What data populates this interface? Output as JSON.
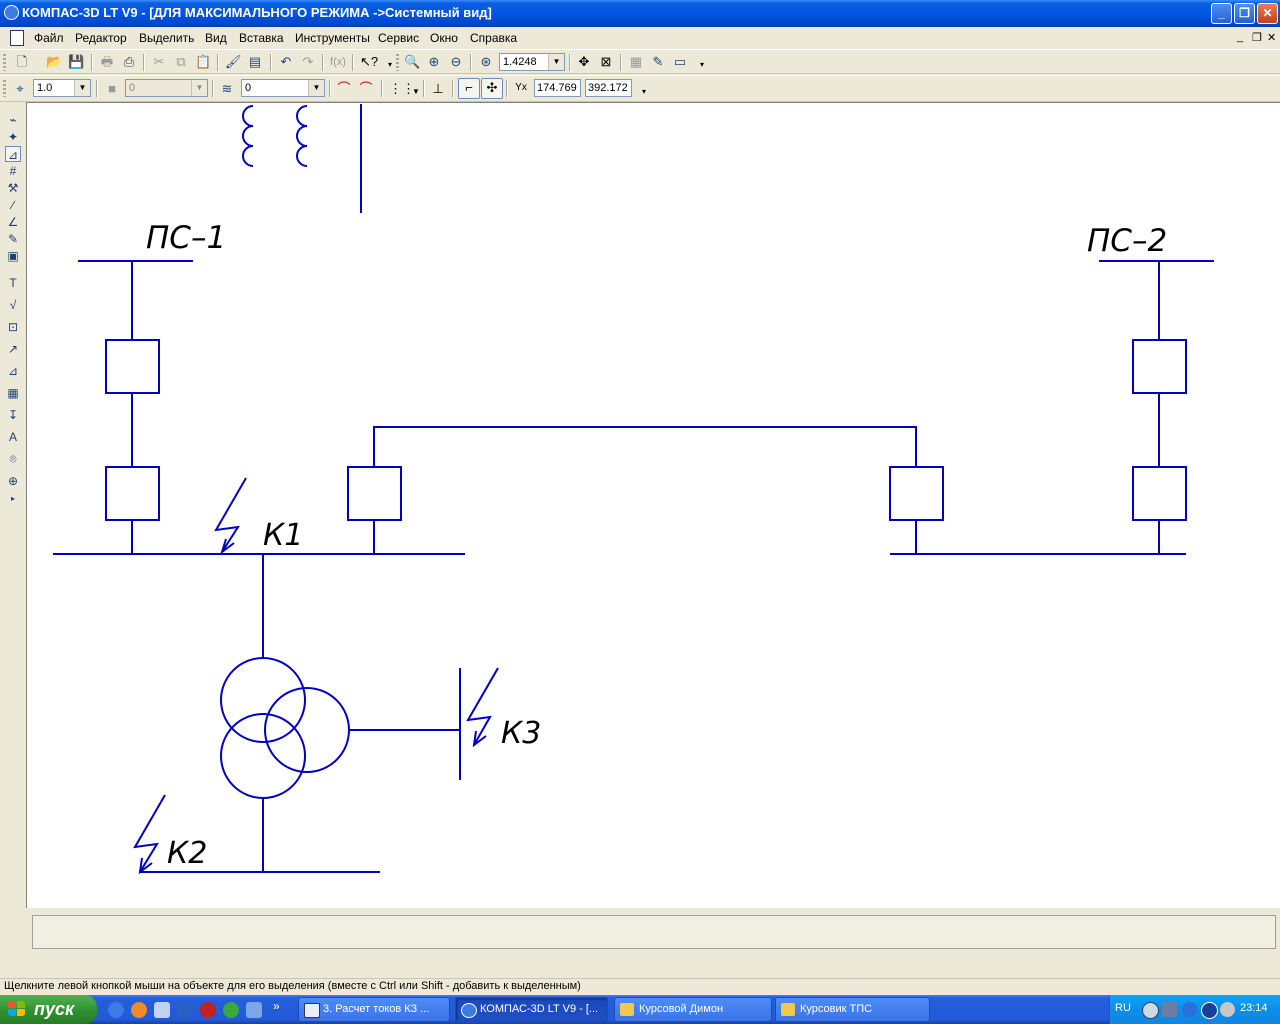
{
  "window": {
    "title": "КОМПАС-3D LT V9 - [ДЛЯ МАКСИМАЛЬНОГО РЕЖИМА ->Системный вид]",
    "minimize": "_",
    "maximize": "❐",
    "close": "✕"
  },
  "menu": {
    "items": [
      "Файл",
      "Редактор",
      "Выделить",
      "Вид",
      "Вставка",
      "Инструменты",
      "Сервис",
      "Окно",
      "Справка"
    ],
    "mdi_min": "_",
    "mdi_restore": "❐",
    "mdi_close": "✕"
  },
  "toolbar1": {
    "zoom_value": "1.4248"
  },
  "toolbar2": {
    "line_scale": "1.0",
    "color_value": "0",
    "layer_value": "0",
    "coord_x": "174.769",
    "coord_y": "392.172"
  },
  "drawing": {
    "labels": {
      "ps1": "ПС–1",
      "ps2": "ПС–2",
      "k1": "К1",
      "k2": "К2",
      "k3": "К3"
    },
    "line_color": "#0000c0"
  },
  "status": {
    "hint": "Щелкните левой кнопкой мыши на объекте для его выделения (вместе с Ctrl или Shift - добавить к выделенным)"
  },
  "taskbar": {
    "start_label": "пуск",
    "tasks": [
      "3. Расчет токов КЗ ...",
      "КОМПАС-3D LT V9 - [...",
      "Курсовой Димон",
      "Курсовик ТПС"
    ],
    "more": "»",
    "language": "RU",
    "clock": "23:14"
  }
}
